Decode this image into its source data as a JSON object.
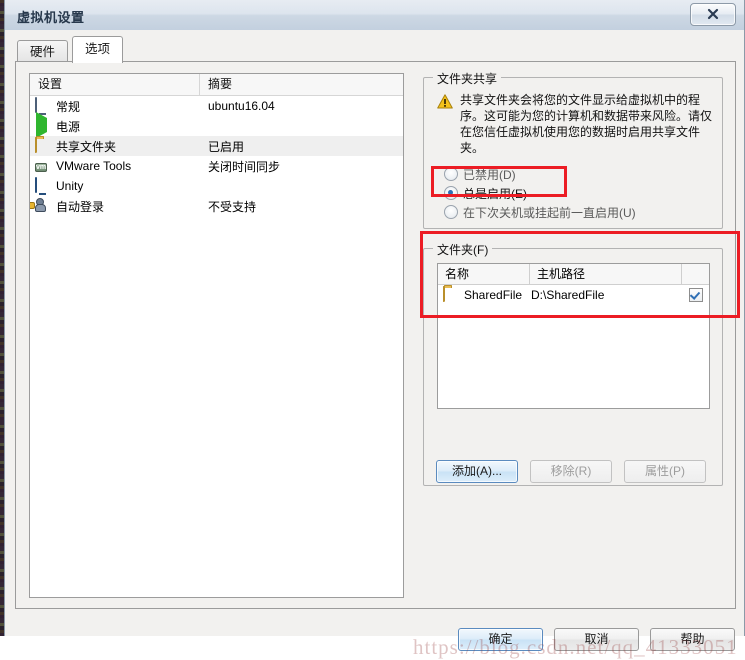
{
  "window": {
    "title": "虚拟机设置",
    "close_label": "✕"
  },
  "tabs": [
    {
      "label": "硬件",
      "active": false
    },
    {
      "label": "选项",
      "active": true
    }
  ],
  "settings_list": {
    "columns": [
      "设置",
      "摘要"
    ],
    "rows": [
      {
        "icon": "monitor-icon",
        "label": "常规",
        "summary": "ubuntu16.04",
        "selected": false
      },
      {
        "icon": "power-icon",
        "label": "电源",
        "summary": "",
        "selected": false
      },
      {
        "icon": "folder-icon",
        "label": "共享文件夹",
        "summary": "已启用",
        "selected": true
      },
      {
        "icon": "vmtools-icon",
        "label": "VMware Tools",
        "summary": "关闭时间同步",
        "selected": false
      },
      {
        "icon": "unity-icon",
        "label": "Unity",
        "summary": "",
        "selected": false
      },
      {
        "icon": "autologin-icon",
        "label": "自动登录",
        "summary": "不受支持",
        "selected": false
      }
    ]
  },
  "sharing_group": {
    "title": "文件夹共享",
    "warning_text": "共享文件夹会将您的文件显示给虚拟机中的程序。这可能为您的计算机和数据带来风险。请仅在您信任虚拟机使用您的数据时启用共享文件夹。",
    "options": [
      {
        "label": "已禁用(D)",
        "checked": false
      },
      {
        "label": "总是启用(E)",
        "checked": true
      },
      {
        "label": "在下次关机或挂起前一直启用(U)",
        "checked": false
      }
    ]
  },
  "folders_group": {
    "title": "文件夹(F)",
    "columns": [
      "名称",
      "主机路径",
      ""
    ],
    "rows": [
      {
        "name": "SharedFile",
        "host_path": "D:\\SharedFile",
        "enabled": true
      }
    ],
    "buttons": [
      {
        "label": "添加(A)...",
        "enabled": true
      },
      {
        "label": "移除(R)",
        "enabled": false
      },
      {
        "label": "属性(P)",
        "enabled": false
      }
    ]
  },
  "dialog_buttons": [
    {
      "label": "确定",
      "default": true
    },
    {
      "label": "取消",
      "default": false
    },
    {
      "label": "帮助",
      "default": false
    }
  ],
  "watermark": "https://blog.csdn.net/qq_41333051",
  "colors": {
    "accent": "#2f6fb5",
    "annotation": "#ec1c24",
    "titlebar": "#cdd8e4"
  }
}
